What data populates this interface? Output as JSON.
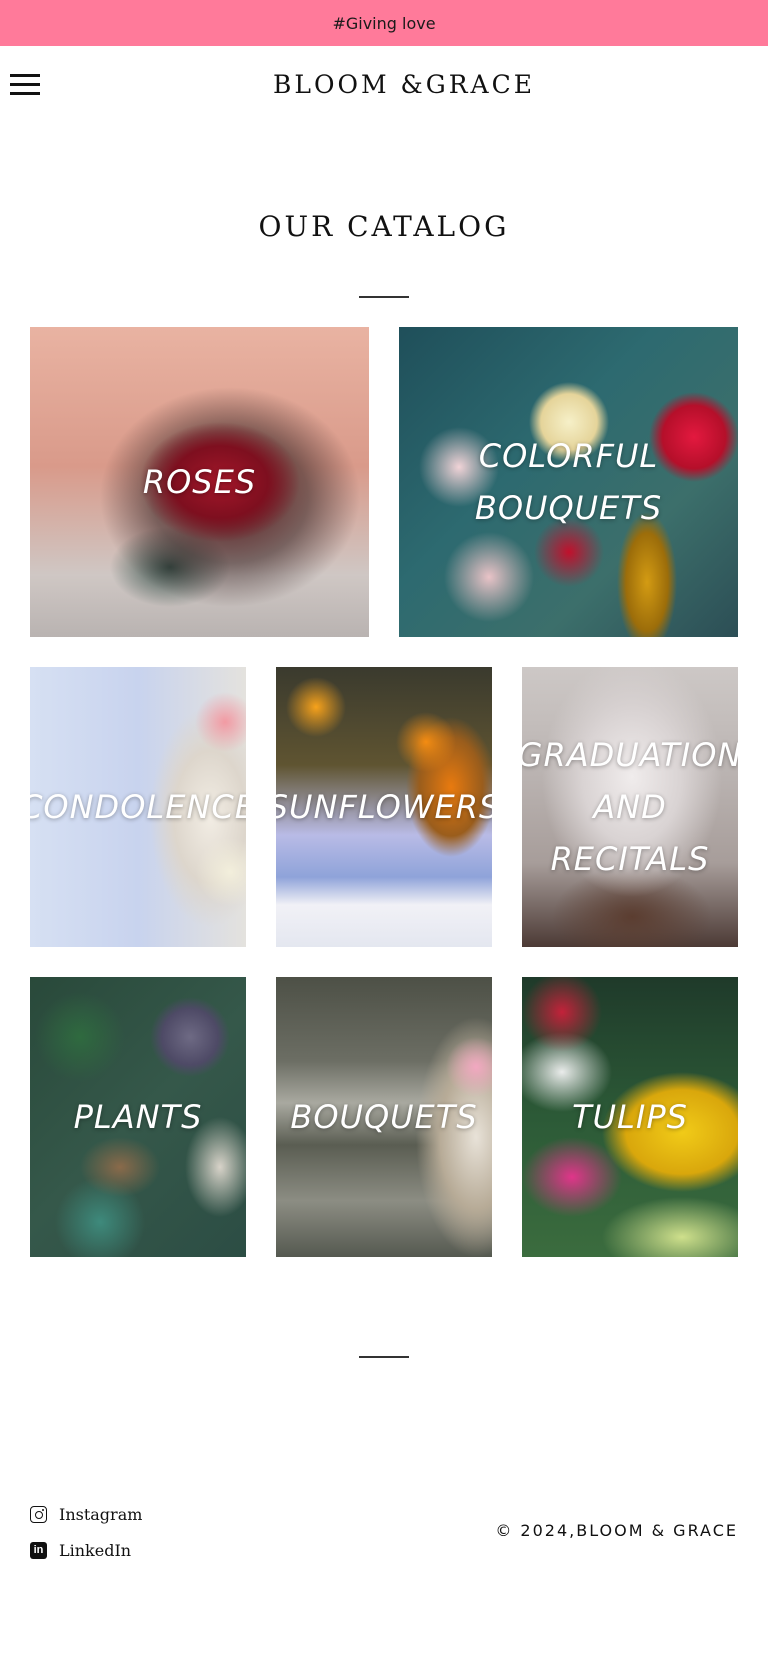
{
  "announcement": "#Giving love",
  "header": {
    "brand": "BLOOM &GRACE",
    "menu_icon": "hamburger-icon"
  },
  "catalog": {
    "title": "OUR CATALOG",
    "tiles": [
      {
        "label": "ROSES"
      },
      {
        "label": "COLORFUL\nBOUQUETS"
      },
      {
        "label": "CONDOLENCE"
      },
      {
        "label": "SUNFLOWERS"
      },
      {
        "label": "GRADUATION\nAND\nRECITALS"
      },
      {
        "label": "PLANTS"
      },
      {
        "label": "BOUQUETS"
      },
      {
        "label": "TULIPS"
      }
    ]
  },
  "footer": {
    "social": [
      {
        "label": "Instagram",
        "icon": "instagram-icon"
      },
      {
        "label": "LinkedIn",
        "icon": "linkedin-icon",
        "glyph": "in"
      }
    ],
    "copyright": "© 2024,BLOOM & GRACE"
  },
  "colors": {
    "announcement_bg": "#ff7a9a",
    "text": "#111111",
    "tile_label": "#ffffff"
  }
}
